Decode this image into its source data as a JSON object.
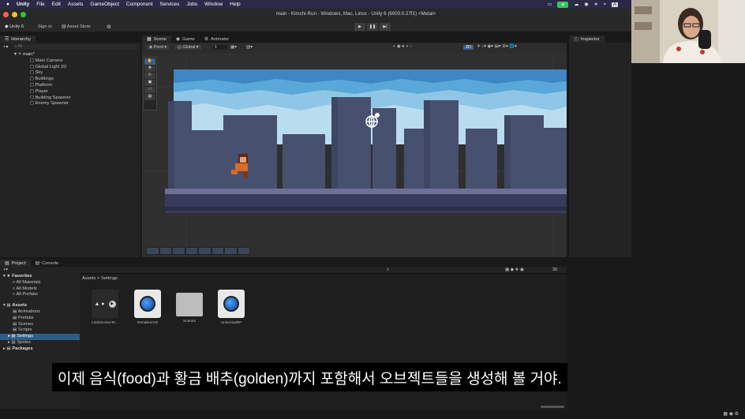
{
  "menu": {
    "apple": "",
    "app": "Unity",
    "items": [
      "File",
      "Edit",
      "Assets",
      "GameObject",
      "Component",
      "Services",
      "Jobs",
      "Window",
      "Help"
    ]
  },
  "status": {
    "lang": "A"
  },
  "window": {
    "title": "main - Kimchi-Run - Windows, Mac, Linux - Unity 6 (6000.0.27f1) <Metal>"
  },
  "toolbar": {
    "account": "Unity 6",
    "sign_in": "Sign in",
    "asset_store": "Asset Store"
  },
  "hierarchy": {
    "tab": "Hierarchy",
    "search_placeholder": "All",
    "scene": "main*",
    "items": [
      "Main Camera",
      "Global Light 2D",
      "Sky",
      "Buildings",
      "Platform",
      "Player",
      "Building Spawner",
      "Enemy Spawner"
    ]
  },
  "scene": {
    "tabs": [
      "Scene",
      "Game",
      "Animator"
    ],
    "pivot": "Pivot",
    "global": "Global",
    "grid_value": "1",
    "mode_2d": "2D"
  },
  "inspector": {
    "tab": "Inspector"
  },
  "project": {
    "tabs": [
      "Project",
      "Console"
    ],
    "count": "30",
    "favorites": {
      "label": "Favorites",
      "items": [
        "All Materials",
        "All Models",
        "All Prefabs"
      ]
    },
    "assets": {
      "label": "Assets",
      "items": [
        "Animations",
        "Prefabs",
        "Scenes",
        "Scripts",
        "Settings",
        "Sprites"
      ]
    },
    "packages": "Packages",
    "breadcrumb": "Assets > Settings",
    "files": [
      "Lit2DSceneTe...",
      "Renderer2D",
      "Scenes",
      "UniversalRP"
    ]
  },
  "subtitle": "이제 음식(food)과 황금 배추(golden)까지 포함해서 오브젝트들을 생성해 볼 거야.",
  "colors": {
    "sky": "#5aa8d8",
    "building": "#47506f",
    "platform": "#383a5c",
    "accent": "#2c5d87"
  }
}
